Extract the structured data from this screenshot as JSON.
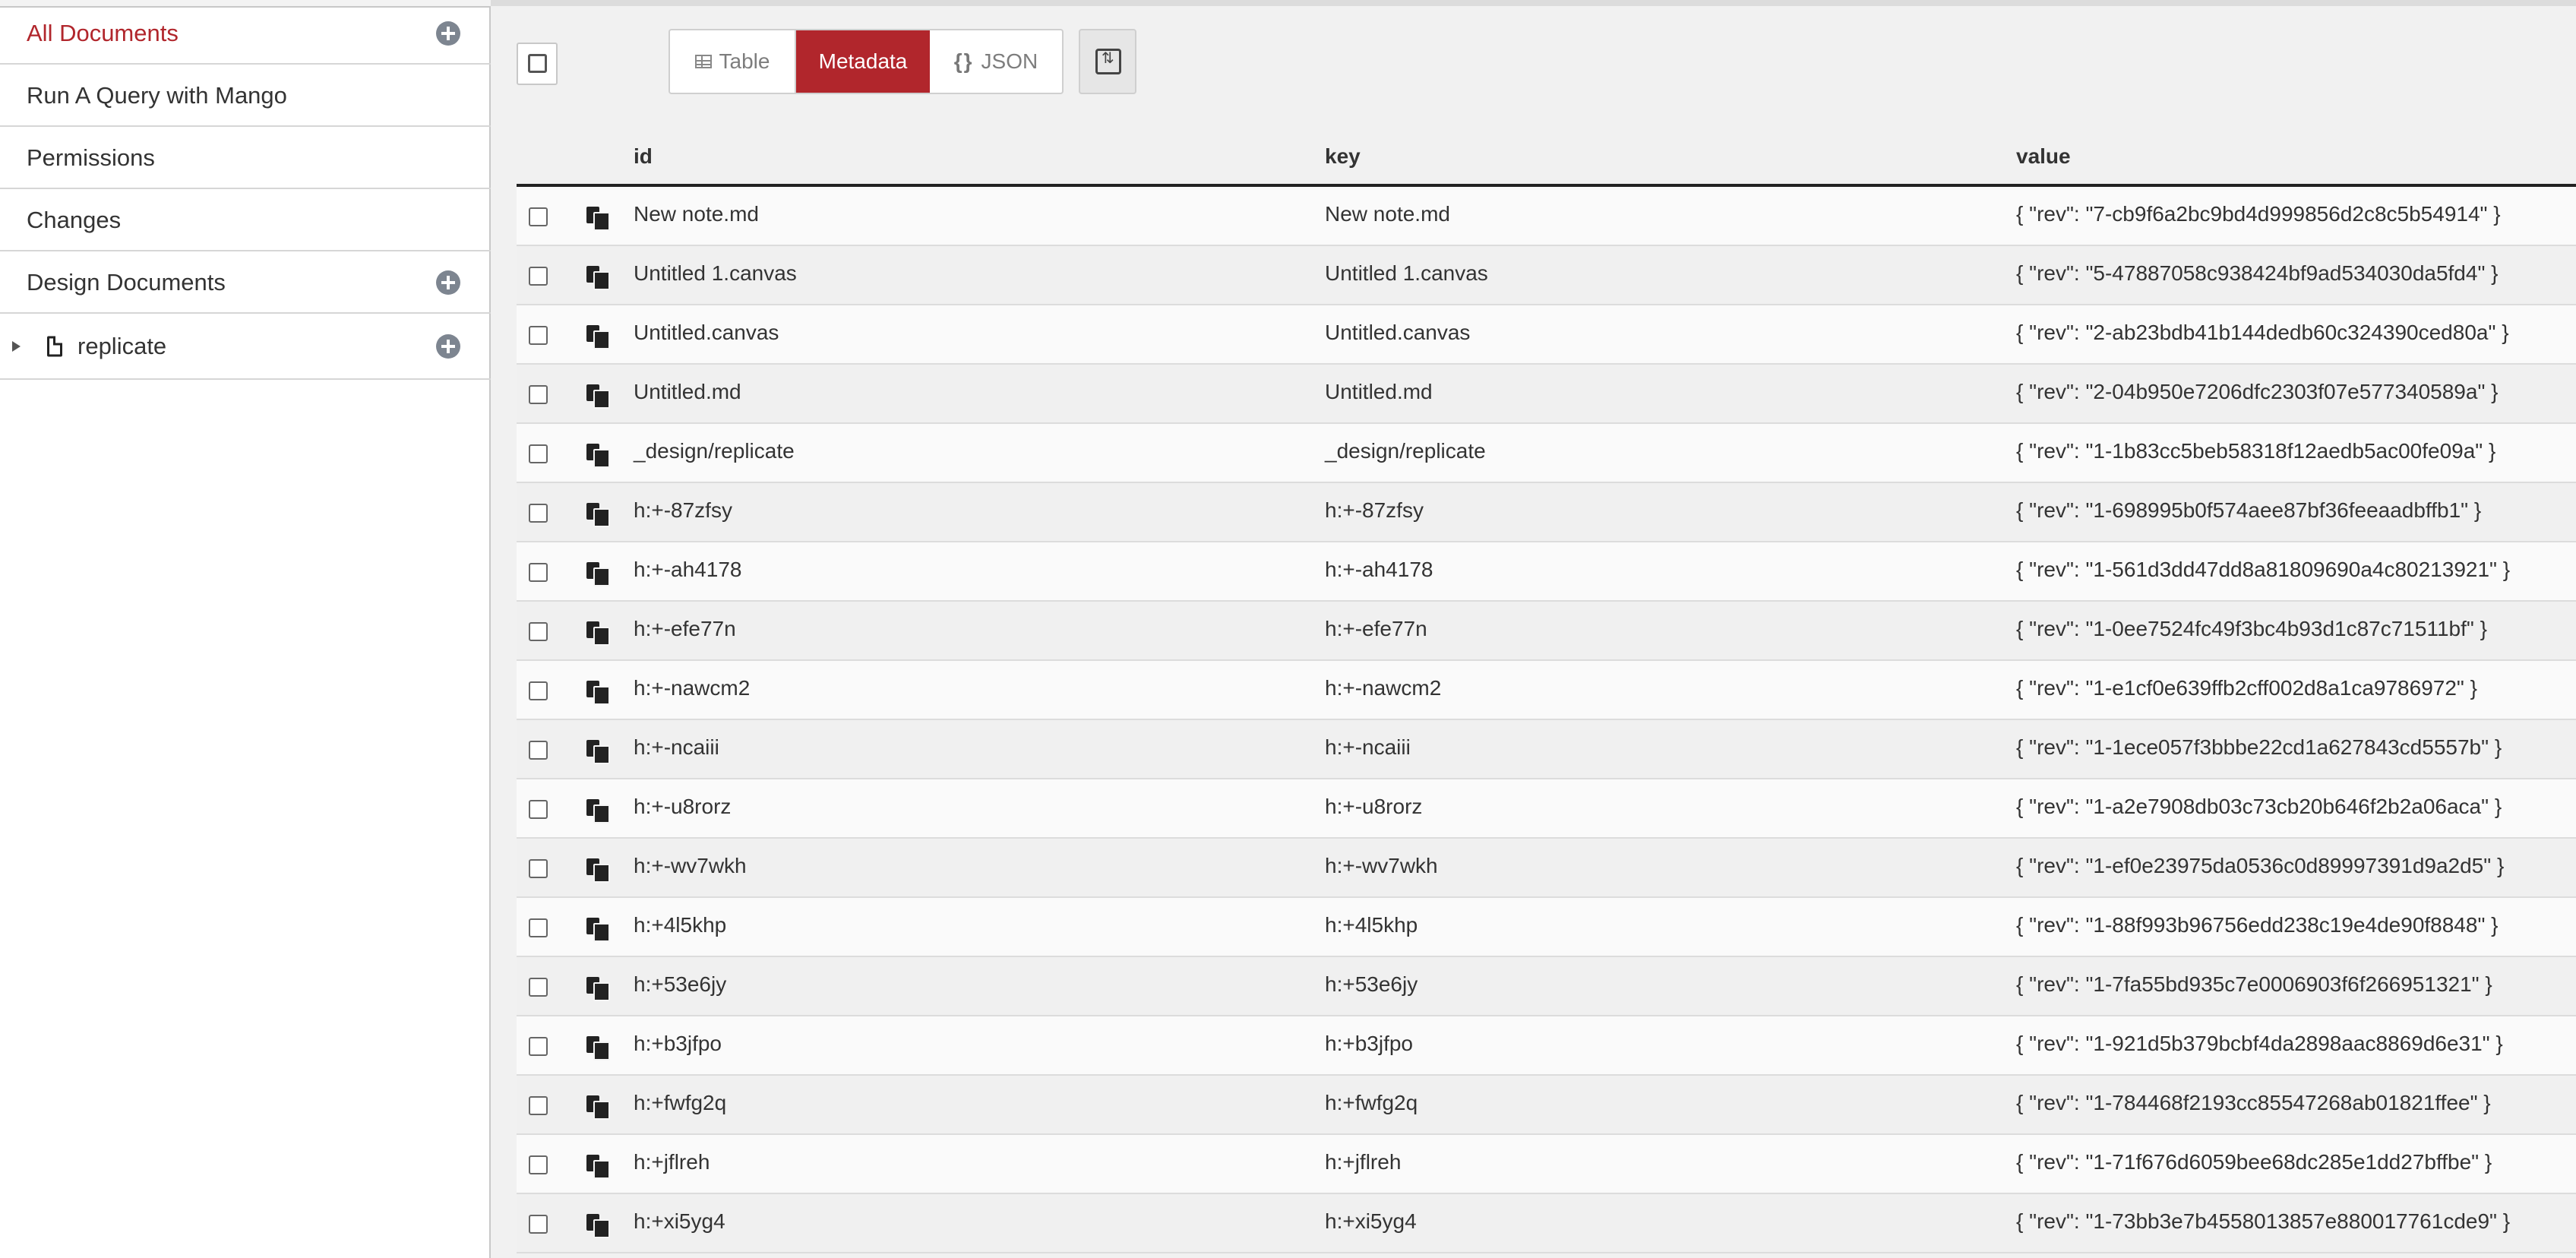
{
  "sidebar": {
    "items": [
      {
        "label": "All Documents",
        "active": true,
        "has_add": true
      },
      {
        "label": "Run A Query with Mango"
      },
      {
        "label": "Permissions"
      },
      {
        "label": "Changes"
      },
      {
        "label": "Design Documents",
        "has_add": true
      }
    ],
    "design_doc": {
      "label": "replicate",
      "has_add": true
    }
  },
  "toolbar": {
    "view_modes": [
      "Table",
      "Metadata",
      "JSON"
    ],
    "active_view": "Metadata",
    "json_brace": "{}"
  },
  "table": {
    "headers": {
      "id": "id",
      "key": "key",
      "value": "value"
    },
    "rows": [
      {
        "id": "New note.md",
        "key": "New note.md",
        "value": "{ \"rev\": \"7-cb9f6a2bc9bd4d999856d2c8c5b54914\" }"
      },
      {
        "id": "Untitled 1.canvas",
        "key": "Untitled 1.canvas",
        "value": "{ \"rev\": \"5-47887058c938424bf9ad534030da5fd4\" }"
      },
      {
        "id": "Untitled.canvas",
        "key": "Untitled.canvas",
        "value": "{ \"rev\": \"2-ab23bdb41b144dedb60c324390ced80a\" }"
      },
      {
        "id": "Untitled.md",
        "key": "Untitled.md",
        "value": "{ \"rev\": \"2-04b950e7206dfc2303f07e577340589a\" }"
      },
      {
        "id": "_design/replicate",
        "key": "_design/replicate",
        "value": "{ \"rev\": \"1-1b83cc5beb58318f12aedb5ac00fe09a\" }"
      },
      {
        "id": "h:+-87zfsy",
        "key": "h:+-87zfsy",
        "value": "{ \"rev\": \"1-698995b0f574aee87bf36feeaadbffb1\" }"
      },
      {
        "id": "h:+-ah4178",
        "key": "h:+-ah4178",
        "value": "{ \"rev\": \"1-561d3dd47dd8a81809690a4c80213921\" }"
      },
      {
        "id": "h:+-efe77n",
        "key": "h:+-efe77n",
        "value": "{ \"rev\": \"1-0ee7524fc49f3bc4b93d1c87c71511bf\" }"
      },
      {
        "id": "h:+-nawcm2",
        "key": "h:+-nawcm2",
        "value": "{ \"rev\": \"1-e1cf0e639ffb2cff002d8a1ca9786972\" }"
      },
      {
        "id": "h:+-ncaiii",
        "key": "h:+-ncaiii",
        "value": "{ \"rev\": \"1-1ece057f3bbbe22cd1a627843cd5557b\" }"
      },
      {
        "id": "h:+-u8rorz",
        "key": "h:+-u8rorz",
        "value": "{ \"rev\": \"1-a2e7908db03c73cb20b646f2b2a06aca\" }"
      },
      {
        "id": "h:+-wv7wkh",
        "key": "h:+-wv7wkh",
        "value": "{ \"rev\": \"1-ef0e23975da0536c0d89997391d9a2d5\" }"
      },
      {
        "id": "h:+4l5khp",
        "key": "h:+4l5khp",
        "value": "{ \"rev\": \"1-88f993b96756edd238c19e4de90f8848\" }"
      },
      {
        "id": "h:+53e6jy",
        "key": "h:+53e6jy",
        "value": "{ \"rev\": \"1-7fa55bd935c7e0006903f6f266951321\" }"
      },
      {
        "id": "h:+b3jfpo",
        "key": "h:+b3jfpo",
        "value": "{ \"rev\": \"1-921d5b379bcbf4da2898aac8869d6e31\" }"
      },
      {
        "id": "h:+fwfg2q",
        "key": "h:+fwfg2q",
        "value": "{ \"rev\": \"1-784468f2193cc85547268ab01821ffee\" }"
      },
      {
        "id": "h:+jflreh",
        "key": "h:+jflreh",
        "value": "{ \"rev\": \"1-71f676d6059bee68dc285e1dd27bffbe\" }"
      },
      {
        "id": "h:+xi5yg4",
        "key": "h:+xi5yg4",
        "value": "{ \"rev\": \"1-73bb3e7b4558013857e880017761cde9\" }"
      }
    ]
  },
  "colors": {
    "accent": "#b1262c",
    "sidebar_bg": "#ffffff",
    "main_bg": "#f1f1f1"
  },
  "icons": [
    "plus-circle-icon",
    "caret-right-icon",
    "file-icon",
    "table-icon",
    "json-braces-icon",
    "column-toggle-icon",
    "copy-icon",
    "checkbox-icon"
  ]
}
